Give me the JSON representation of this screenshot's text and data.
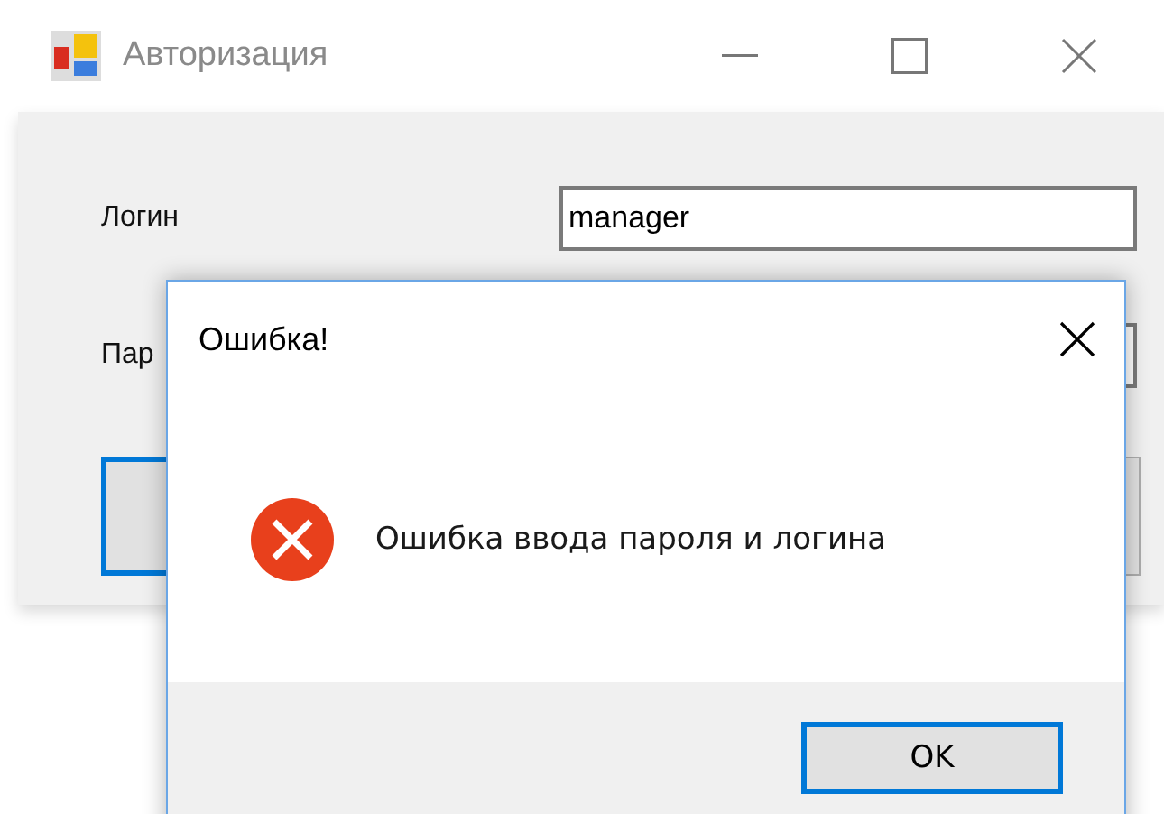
{
  "window": {
    "title": "Авторизация"
  },
  "form": {
    "login_label": "Логин",
    "login_value": "manager",
    "password_label": "Пар"
  },
  "dialog": {
    "title": "Ошибка!",
    "message": "Ошибка ввода пароля и логина",
    "button": "OK",
    "button_focused": true
  }
}
